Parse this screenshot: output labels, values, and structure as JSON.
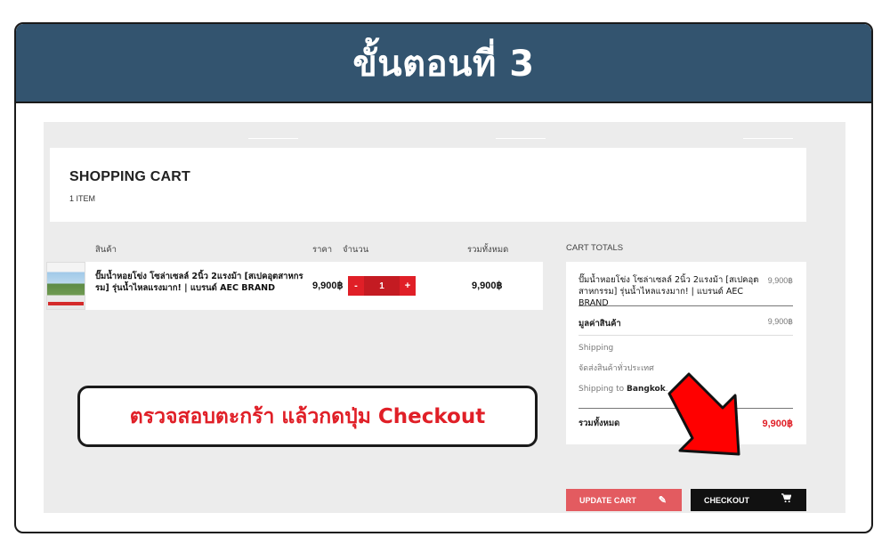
{
  "banner": {
    "title": "ขั้นตอนที่ 3"
  },
  "cart": {
    "title": "SHOPPING CART",
    "item_count": "1 ITEM",
    "columns": {
      "product": "สินค้า",
      "price": "ราคา",
      "quantity": "จำนวน",
      "total": "รวมทั้งหมด"
    },
    "item": {
      "name": "ปั๊มน้ำหอยโข่ง โซล่าเซลล์ 2นิ้ว 2แรงม้า [สเปคอุตสาหกรรม] รุ่นน้ำไหลแรงมาก! | แบรนด์ AEC BRAND",
      "price": "9,900฿",
      "quantity": "1",
      "minus": "-",
      "plus": "+",
      "total": "9,900฿"
    }
  },
  "totals": {
    "heading": "CART TOTALS",
    "item_name": "ปั๊มน้ำหอยโข่ง โซล่าเซลล์ 2นิ้ว 2แรงม้า [สเปคอุตสาหกรรม] รุ่นน้ำไหลแรงมาก! | แบรนด์ AEC BRAND",
    "item_price": "9,900฿",
    "subtotal_label": "มูลค่าสินค้า",
    "subtotal_value": "9,900฿",
    "shipping_label": "Shipping",
    "shipping_note": "จัดส่งสินค้าทั่วประเทศ",
    "shipping_to_prefix": "Shipping to ",
    "shipping_to_city": "Bangkok",
    "shipping_to_suffix": ".",
    "grand_label": "รวมทั้งหมด",
    "grand_value": "9,900฿"
  },
  "buttons": {
    "update_cart": "UPDATE CART",
    "checkout": "CHECKOUT",
    "update_icon": "pencil-icon",
    "checkout_icon": "cart-icon"
  },
  "callout": {
    "text": "ตรวจสอบตะกร้า แล้วกดปุ่ม Checkout"
  },
  "colors": {
    "banner": "#33546f",
    "accent_red": "#e01f27",
    "update_btn": "#e35b60",
    "checkout_btn": "#111111"
  }
}
